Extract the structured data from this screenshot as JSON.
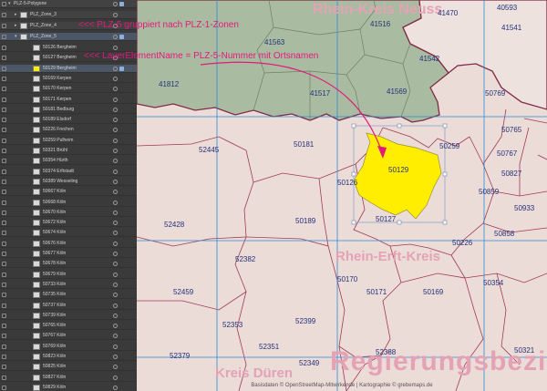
{
  "layers": {
    "groups": [
      {
        "label": "PLZ-5-Polygone"
      },
      {
        "label": "PLZ_Zone_3"
      },
      {
        "label": "PLZ_Zone_4"
      },
      {
        "label": "PLZ_Zone_5"
      }
    ],
    "items": [
      {
        "label": "50126 Bergheim"
      },
      {
        "label": "50127 Bergheim"
      },
      {
        "label": "50129 Bergheim"
      },
      {
        "label": "50169 Kerpen"
      },
      {
        "label": "50170 Kerpen"
      },
      {
        "label": "50171 Kerpen"
      },
      {
        "label": "50181 Bedburg"
      },
      {
        "label": "50189 Elsdorf"
      },
      {
        "label": "50226 Frechen"
      },
      {
        "label": "50259 Pulheim"
      },
      {
        "label": "50321 Brühl"
      },
      {
        "label": "50354 Hürth"
      },
      {
        "label": "50374 Erftstadt"
      },
      {
        "label": "50389 Wesseling"
      },
      {
        "label": "50667 Köln"
      },
      {
        "label": "50668 Köln"
      },
      {
        "label": "50670 Köln"
      },
      {
        "label": "50672 Köln"
      },
      {
        "label": "50674 Köln"
      },
      {
        "label": "50676 Köln"
      },
      {
        "label": "50677 Köln"
      },
      {
        "label": "50678 Köln"
      },
      {
        "label": "50679 Köln"
      },
      {
        "label": "50733 Köln"
      },
      {
        "label": "50735 Köln"
      },
      {
        "label": "50737 Köln"
      },
      {
        "label": "50739 Köln"
      },
      {
        "label": "50765 Köln"
      },
      {
        "label": "50767 Köln"
      },
      {
        "label": "50769 Köln"
      },
      {
        "label": "50823 Köln"
      },
      {
        "label": "50825 Köln"
      },
      {
        "label": "50827 Köln"
      },
      {
        "label": "50829 Köln"
      }
    ]
  },
  "annotations": {
    "group_note": "<<< PLZ-5 gruppiert nach PLZ-1-Zonen",
    "name_note": "<<< LayerElementName = PLZ-5-Nummer mit Ortsnamen"
  },
  "map": {
    "regions": {
      "top": "Rhein-Kreis Neuss",
      "erft": "Rhein-Erft-Kreis",
      "bezirk": "Regierungsbezirk Kö",
      "dueren": "Kreis Düren"
    },
    "plz_labels": {
      "p41470": "41470",
      "p40593": "40593",
      "p41516": "41516",
      "p41541": "41541",
      "p41563": "41563",
      "p41542": "41542",
      "p41812": "41812",
      "p41517": "41517",
      "p41569": "41569",
      "p50769": "50769",
      "p50765": "50765",
      "p52445": "52445",
      "p50181": "50181",
      "p50259": "50259",
      "p50767": "50767",
      "p50129": "50129",
      "p50126": "50126",
      "p50827": "50827",
      "p50859": "50859",
      "p50933": "50933",
      "p52428": "52428",
      "p50189": "50189",
      "p50127": "50127",
      "p50858": "50858",
      "p50226": "50226",
      "p52382": "52382",
      "p50170": "50170",
      "p50354": "50354",
      "p52459": "52459",
      "p50171": "50171",
      "p50169": "50169",
      "p52353": "52353",
      "p52399": "52399",
      "p52351": "52351",
      "p52379": "52379",
      "p52388": "52388",
      "p50321": "50321",
      "p52349": "52349"
    },
    "footer": "Basisdaten © OpenStreetMap-Mitwirkende | Kartographie © grebemaps.de"
  },
  "colors": {
    "highlight": "#ffee00",
    "north_zone": "#a9bca1",
    "map_bg": "#ecdcd8",
    "grid": "#2b8bd6",
    "district_border": "#a03a55",
    "annotation": "#e3197b"
  }
}
